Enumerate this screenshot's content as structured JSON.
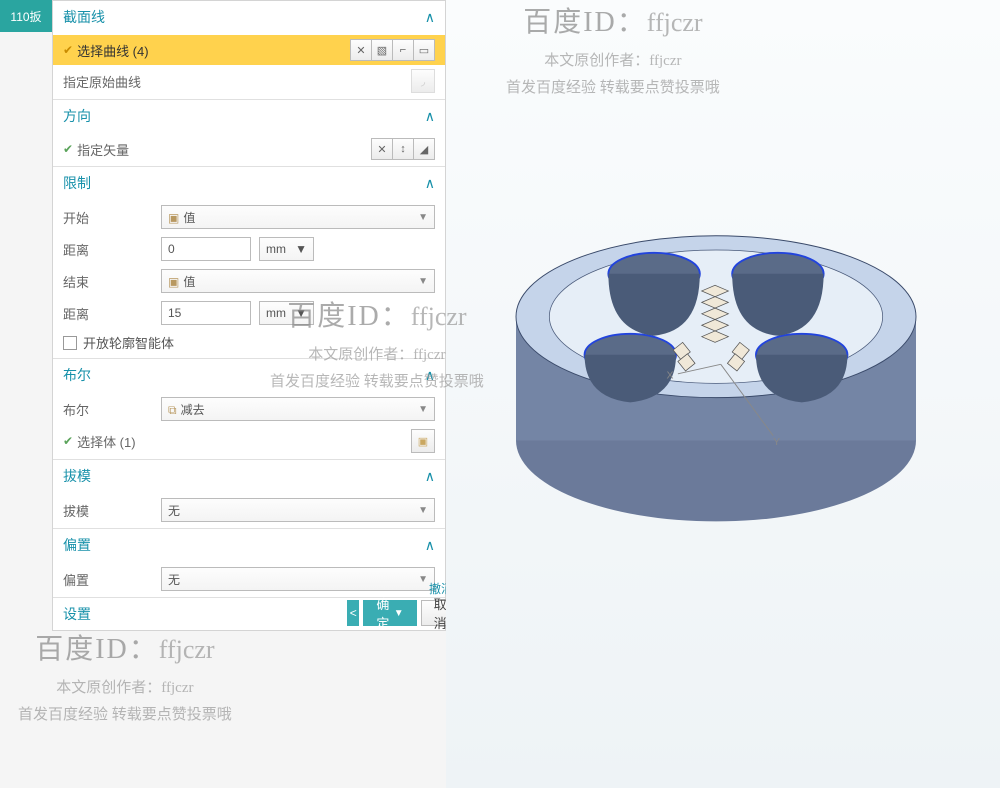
{
  "tab_label": "110扳",
  "sections": {
    "curves": {
      "title": "截面线",
      "select_curve": "选择曲线 (4)",
      "specify_orig": "指定原始曲线"
    },
    "direction": {
      "title": "方向",
      "specify_vector": "指定矢量"
    },
    "limits": {
      "title": "限制",
      "start_label": "开始",
      "start_value": "值",
      "dist1_label": "距离",
      "dist1_value": "0",
      "unit": "mm",
      "end_label": "结束",
      "end_value": "值",
      "dist2_label": "距离",
      "dist2_value": "15",
      "open_profile": "开放轮廓智能体"
    },
    "boolean": {
      "title": "布尔",
      "bool_label": "布尔",
      "bool_value": "减去",
      "select_body": "选择体 (1)"
    },
    "draft": {
      "title": "拔模",
      "draft_label": "拔模",
      "draft_value": "无"
    },
    "offset": {
      "title": "偏置",
      "offset_label": "偏置",
      "offset_value": "无"
    },
    "settings": {
      "title": "设置"
    }
  },
  "undo_result": "撤消结果",
  "ok": "确定",
  "cancel": "取消",
  "watermark": {
    "line1a": "百度ID：",
    "line1b": "ffjczr",
    "line2": "本文原创作者：ffjczr",
    "line3": "首发百度经验 转载要点赞投票哦"
  }
}
